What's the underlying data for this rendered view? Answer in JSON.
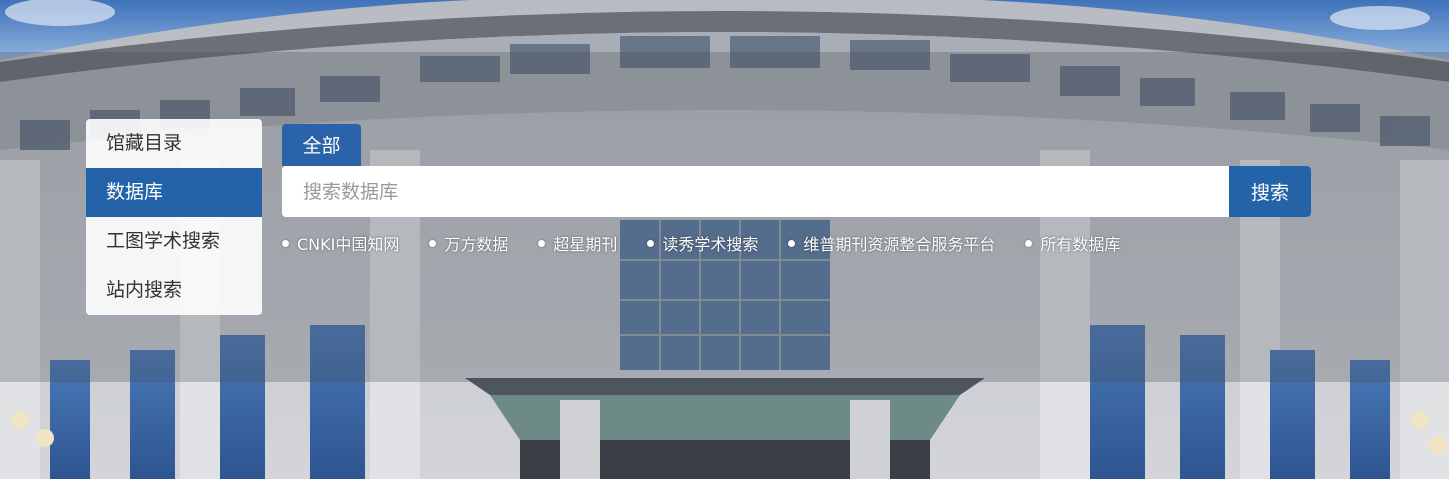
{
  "tabs": [
    {
      "label": "馆藏目录",
      "active": false
    },
    {
      "label": "数据库",
      "active": true
    },
    {
      "label": "工图学术搜索",
      "active": false
    },
    {
      "label": "站内搜索",
      "active": false
    }
  ],
  "search": {
    "scope_label": "全部",
    "placeholder": "搜索数据库",
    "button_label": "搜索"
  },
  "quick_links": [
    {
      "label": "CNKI中国知网"
    },
    {
      "label": "万方数据"
    },
    {
      "label": "超星期刊"
    },
    {
      "label": "读秀学术搜索"
    },
    {
      "label": "维普期刊资源整合服务平台"
    },
    {
      "label": "所有数据库"
    }
  ],
  "colors": {
    "accent": "#2563a9",
    "sky": "#4f7fc2",
    "facade": "#c9cbd0"
  }
}
